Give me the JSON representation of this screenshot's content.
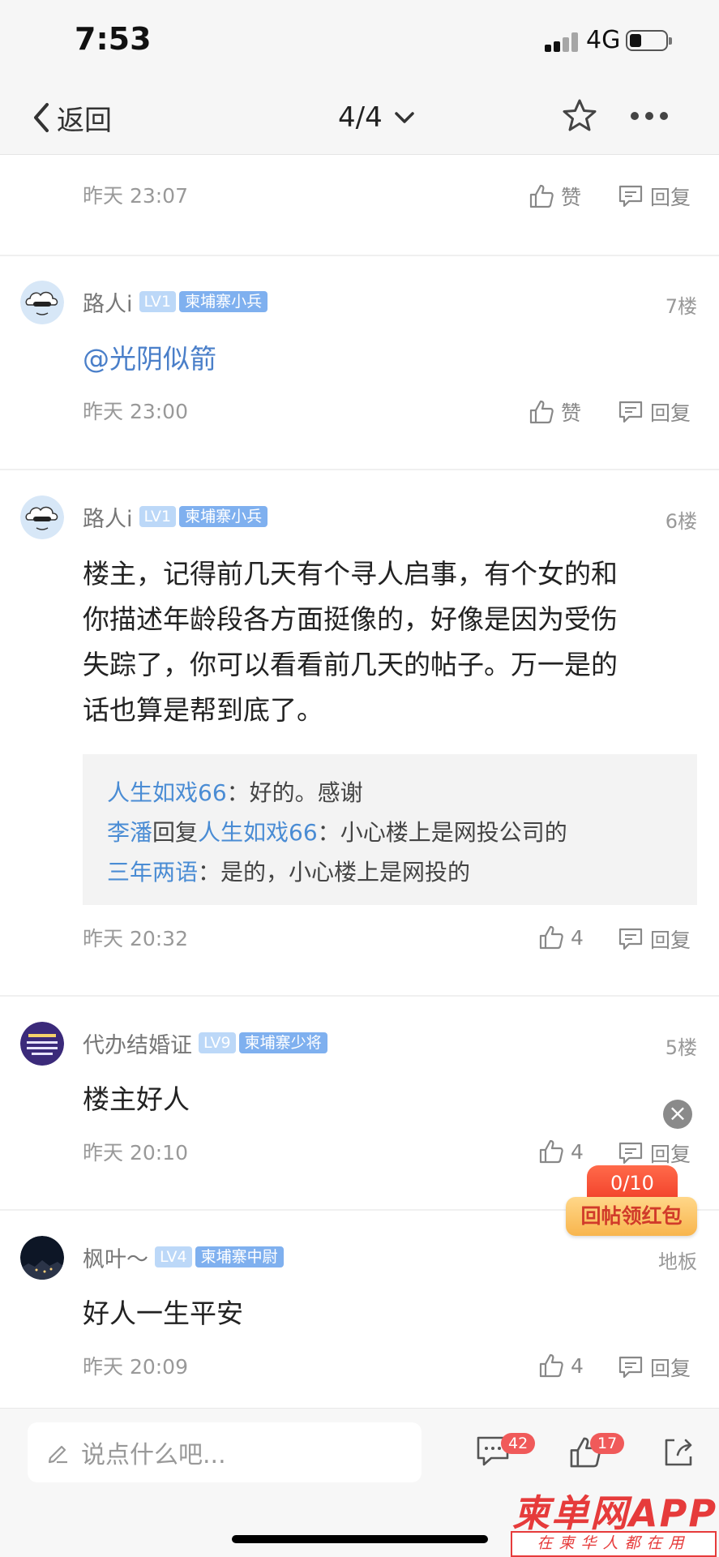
{
  "status_bar": {
    "time": "7:53",
    "network": "4G"
  },
  "nav": {
    "back_label": "返回",
    "page_indicator": "4/4"
  },
  "partial_top": {
    "time": "昨天 23:07",
    "like_label": "赞",
    "reply_label": "回复"
  },
  "comments": [
    {
      "username": "路人i",
      "level": "LV1",
      "title": "柬埔寨小兵",
      "floor": "7楼",
      "text": "@光阴似箭",
      "time": "昨天 23:00",
      "likes": "赞",
      "reply_label": "回复"
    },
    {
      "username": "路人i",
      "level": "LV1",
      "title": "柬埔寨小兵",
      "floor": "6楼",
      "text_lines": [
        "楼主，记得前几天有个寻人启事，有个女的和",
        "你描述年龄段各方面挺像的，好像是因为受伤",
        "失踪了，你可以看看前几天的帖子。万一是的",
        "话也算是帮到底了。"
      ],
      "replies": [
        {
          "name": "人生如戏66",
          "sep": "：",
          "text": "好的。感谢"
        },
        {
          "name": "李潘",
          "mid": "回复",
          "target": "人生如戏66",
          "sep": "：",
          "text": "小心楼上是网投公司的"
        },
        {
          "name": "三年两语",
          "sep": "：",
          "text": "是的，小心楼上是网投的"
        }
      ],
      "time": "昨天 20:32",
      "likes": "4",
      "reply_label": "回复"
    },
    {
      "username": "代办结婚证",
      "level": "LV9",
      "title": "柬埔寨少将",
      "floor": "5楼",
      "text": "楼主好人",
      "time": "昨天 20:10",
      "likes": "4",
      "reply_label": "回复"
    },
    {
      "username": "枫叶～",
      "level": "LV4",
      "title": "柬埔寨中尉",
      "floor": "地板",
      "text": "好人一生平安",
      "time": "昨天 20:09",
      "likes": "4",
      "reply_label": "回复"
    }
  ],
  "red_packet": {
    "progress": "0/10",
    "label": "回帖领红包"
  },
  "bottom": {
    "placeholder": "说点什么吧...",
    "comment_count": "42",
    "like_count": "17"
  },
  "watermark": {
    "brand": "柬单网APP",
    "slogan": "在柬华人都在用"
  },
  "colors": {
    "accent_blue": "#4a8cd4",
    "level_badge": "#bcd8f8",
    "title_badge": "#7fb0ef",
    "red": "#f05a5a"
  }
}
